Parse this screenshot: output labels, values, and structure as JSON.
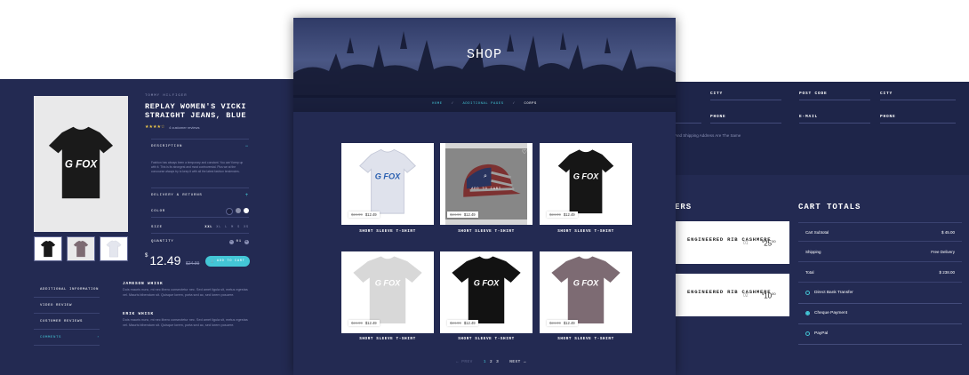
{
  "product_page": {
    "brand": "TOMMY HILFIGER",
    "title": "REPLAY WOMEN'S VICKI STRAIGHT JEANS, BLUE",
    "stars": "★★★★☆",
    "reviews": "4 customer reviews",
    "description_label": "DESCRIPTION",
    "description_text": "Fashion has always been a temporary and constant. You can't keep up with it. This is its strongest and most controversial. Plus we at the concourse always try to keep it with all the latest fashion tendencies.",
    "delivery_label": "DELIVERY & RETURNS",
    "color_label": "COLOR",
    "colors": [
      "#1a1f3e",
      "#8a8fa8",
      "#ffffff"
    ],
    "size_label": "SIZE",
    "sizes": [
      "XXL",
      "XL",
      "L",
      "M",
      "S",
      "XS"
    ],
    "quantity_label": "QUANTITY",
    "quantity": "01",
    "currency": "$",
    "price": "12.49",
    "old_price": "$24.99",
    "add_to_cart": "ADD TO CART",
    "nav": [
      "ADDITIONAL INFORMATION",
      "VIDEO REVIEW",
      "CUSTOMER REVIEWS",
      "COMMENTS"
    ],
    "reviews_list": [
      {
        "name": "JAMESON WHISK",
        "text": "Duis mauris nunc, mi nec libero consectetur nec. Sed amet ligula sit, metus egestas vel. Mauris bibendum sit. Quisque lorem, porta sed ac, sed lorem posuere."
      },
      {
        "name": "ERIK WHISK",
        "text": "Duis mauris nunc, mi nec libero consectetur nec. Sed amet ligula sit, metus egestas vel. Mauris bibendum sit. Quisque lorem, porta sed ac, sed lorem posuere."
      }
    ]
  },
  "shop": {
    "hero_title": "SHOP",
    "breadcrumb": [
      "HOME",
      "ADDITIONAL PAGES",
      "CORPS"
    ],
    "products": [
      {
        "name": "SHORT SLEEVE T-SHIRT",
        "old": "$24.99",
        "price": "$12.49"
      },
      {
        "name": "SHORT SLEEVE T-SHIRT",
        "old": "$24.99",
        "price": "$12.49",
        "overlay": "ADD TO CART"
      },
      {
        "name": "SHORT SLEEVE T-SHIRT",
        "old": "$24.99",
        "price": "$12.49"
      },
      {
        "name": "SHORT SLEEVE T-SHIRT",
        "old": "$24.99",
        "price": "$12.49"
      },
      {
        "name": "SHORT SLEEVE T-SHIRT",
        "old": "$24.99",
        "price": "$12.49"
      },
      {
        "name": "SHORT SLEEVE T-SHIRT",
        "old": "$24.99",
        "price": "$12.49"
      }
    ],
    "pager": {
      "prev": "← PREV",
      "pages": [
        "1",
        "2",
        "3"
      ],
      "next": "NEXT →"
    }
  },
  "checkout": {
    "fields": [
      "CITY",
      "POST CODE",
      "CITY",
      "PHONE",
      "E-MAIL",
      "PHONE"
    ],
    "note": "And Shipping Address Are The Same",
    "cart_heading": "ERS",
    "totals_heading": "CART TOTALS",
    "items": [
      {
        "name": "ENGINEERED RIB CASHMERE",
        "num": "01",
        "price": "25",
        "dec": "00"
      },
      {
        "name": "ENGINEERED RIB CASHMERE",
        "num": "02",
        "price": "10",
        "dec": "00"
      }
    ],
    "rows": [
      {
        "label": "Cart Subtotal",
        "value": "$ 45.00"
      },
      {
        "label": "Shipping",
        "value": "Free Delivery"
      },
      {
        "label": "Total",
        "value": "$ 238.00"
      }
    ],
    "payments": [
      "Direct Bank Transfer",
      "Cheque Payment",
      "PayPal"
    ],
    "selected_payment": 1
  },
  "colors": {
    "accent": "#43c6d6",
    "panel": "#232a52",
    "star": "#e9c44a"
  }
}
